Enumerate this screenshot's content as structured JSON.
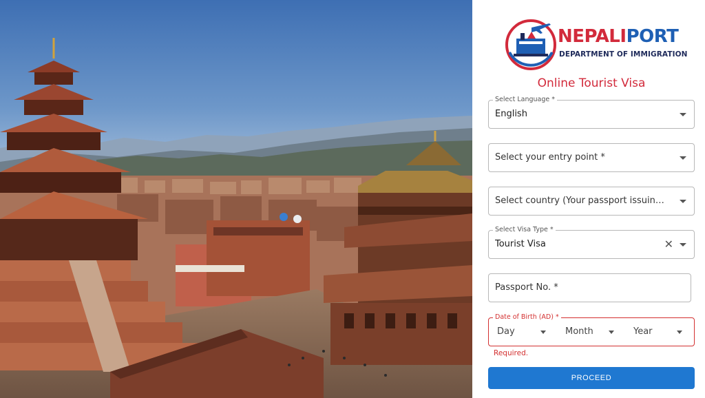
{
  "brand": {
    "name_part1": "NEPALI",
    "name_part2": "PORT",
    "subtitle": "DEPARTMENT OF IMMIGRATION"
  },
  "form": {
    "title": "Online Tourist Visa",
    "language": {
      "label": "Select Language *",
      "value": "English"
    },
    "entry_point": {
      "placeholder": "Select your entry point *"
    },
    "country": {
      "placeholder": "Select country (Your passport issuing country) *"
    },
    "visa_type": {
      "label": "Select Visa Type *",
      "value": "Tourist Visa"
    },
    "passport": {
      "placeholder": "Passport No. *"
    },
    "dob": {
      "label": "Date of Birth (AD) *",
      "day": "Day",
      "month": "Month",
      "year": "Year",
      "error": "Required."
    },
    "proceed_label": "PROCEED"
  },
  "colors": {
    "brand_red": "#d22a3b",
    "brand_blue": "#1e5fb4",
    "button_blue": "#1f78d1",
    "error_red": "#d32f2f"
  },
  "icons": [
    "dropdown-caret-icon",
    "clear-icon",
    "airplane-icon"
  ]
}
